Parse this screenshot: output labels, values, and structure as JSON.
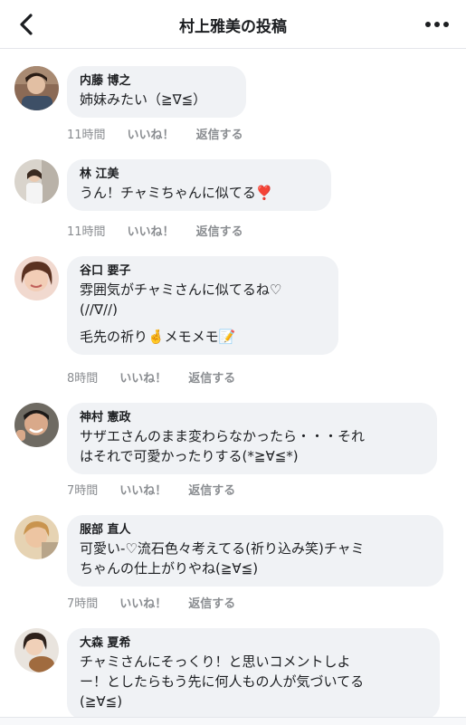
{
  "header": {
    "title": "村上雅美の投稿",
    "back_icon": "chevron-left-icon",
    "more_icon": "more-dots-icon"
  },
  "comments": [
    {
      "name": "内藤 博之",
      "lines": [
        "姉妹みたい（≧∇≦）"
      ],
      "time": "11時間",
      "like": "いいね！",
      "reply": "返信する"
    },
    {
      "name": "林 江美",
      "lines": [
        "うん！チャミちゃんに似てる❣️"
      ],
      "time": "11時間",
      "like": "いいね！",
      "reply": "返信する"
    },
    {
      "name": "谷口 要子",
      "lines": [
        "雰囲気がチャミさんに似てるね♡\n(//∇//)",
        "毛先の祈り🤞メモメモ📝"
      ],
      "time": "8時間",
      "like": "いいね！",
      "reply": "返信する"
    },
    {
      "name": "神村 憲政",
      "lines": [
        "サザエさんのまま変わらなかったら・・・それ\nはそれで可愛かったりする(*≧∀≦*)"
      ],
      "time": "7時間",
      "like": "いいね！",
      "reply": "返信する"
    },
    {
      "name": "服部 直人",
      "lines": [
        "可愛い-♡流石色々考えてる(祈り込み笑)チャミ\nちゃんの仕上がりやね(≧∀≦)"
      ],
      "time": "7時間",
      "like": "いいね！",
      "reply": "返信する"
    },
    {
      "name": "大森 夏希",
      "lines": [
        "チャミさんにそっくり！と思いコメントしよ\nー！としたらもう先に何人もの人が気づいてる\n(≧∀≦)"
      ]
    }
  ]
}
